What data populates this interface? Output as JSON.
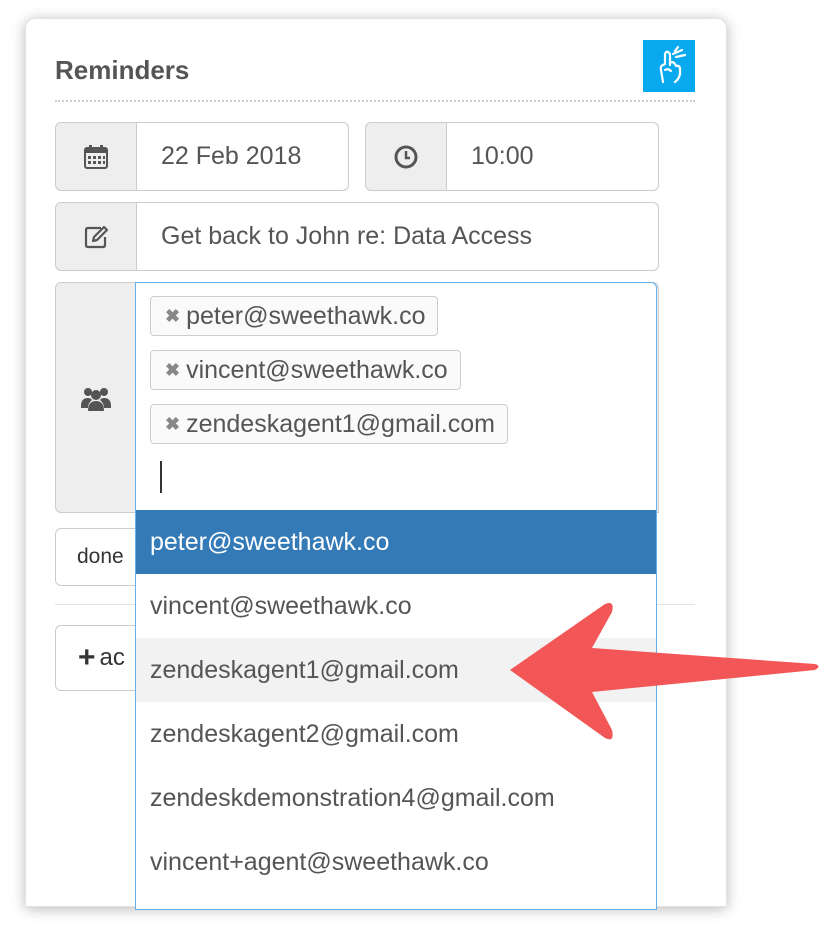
{
  "header": {
    "title": "Reminders",
    "logo_icon": "hand-finger-icon"
  },
  "date_field": {
    "icon": "calendar-icon",
    "value": "22 Feb 2018"
  },
  "time_field": {
    "icon": "clock-icon",
    "value": "10:00"
  },
  "note_field": {
    "icon": "edit-icon",
    "value": "Get back to John re: Data Access"
  },
  "recipients": {
    "icon": "users-icon",
    "tags": [
      {
        "label": "peter@sweethawk.co",
        "remove_glyph": "✖"
      },
      {
        "label": "vincent@sweethawk.co",
        "remove_glyph": "✖"
      },
      {
        "label": "zendeskagent1@gmail.com",
        "remove_glyph": "✖"
      }
    ]
  },
  "dropdown": {
    "options": [
      "peter@sweethawk.co",
      "vincent@sweethawk.co",
      "zendeskagent1@gmail.com",
      "zendeskagent2@gmail.com",
      "zendeskdemonstration4@gmail.com",
      "vincent+agent@sweethawk.co"
    ],
    "active_index": 0,
    "hover_index": 2
  },
  "actions": {
    "done_label": "done",
    "add_label": "ac"
  },
  "colors": {
    "accent": "#337ab7",
    "logo_bg": "#09a9f0",
    "arrow": "#f25656",
    "focus_border": "#66afe9"
  }
}
